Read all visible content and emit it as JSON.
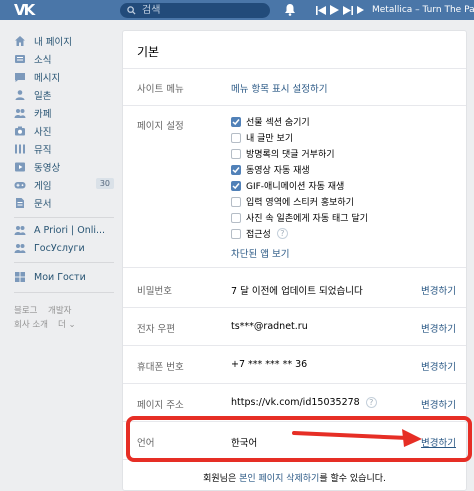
{
  "header": {
    "logo": "VK",
    "search_placeholder": "검색",
    "track": "Metallica – Turn The Page"
  },
  "sidebar": {
    "items": [
      {
        "label": "내 페이지",
        "icon": "home-icon"
      },
      {
        "label": "소식",
        "icon": "news-icon"
      },
      {
        "label": "메시지",
        "icon": "message-icon"
      },
      {
        "label": "일촌",
        "icon": "friends-icon"
      },
      {
        "label": "카페",
        "icon": "groups-icon"
      },
      {
        "label": "사진",
        "icon": "camera-icon"
      },
      {
        "label": "뮤직",
        "icon": "music-icon"
      },
      {
        "label": "동영상",
        "icon": "video-icon"
      },
      {
        "label": "게임",
        "icon": "gamepad-icon",
        "count": "30"
      },
      {
        "label": "문서",
        "icon": "document-icon"
      }
    ],
    "apps": [
      {
        "label": "A Priori | Onli...",
        "icon": "app-icon"
      },
      {
        "label": "ГосУслуги",
        "icon": "app-icon"
      }
    ],
    "extra": [
      {
        "label": "Мои Гости",
        "icon": "grid-icon"
      }
    ],
    "footer": [
      "블로그",
      "개발자",
      "회사 소개",
      "더 ⌄"
    ]
  },
  "settings": {
    "title": "기본",
    "site_menu": {
      "label": "사이트 메뉴",
      "link": "메뉴 항목 표시 설정하기"
    },
    "page_settings": {
      "label": "페이지 설정",
      "options": [
        {
          "label": "선물 섹션 숨기기",
          "checked": true
        },
        {
          "label": "내 글만 보기",
          "checked": false
        },
        {
          "label": "방명록의 댓글 거부하기",
          "checked": false
        },
        {
          "label": "동영상 자동 재생",
          "checked": true
        },
        {
          "label": "GIF-애니메이션 자동 재생",
          "checked": true
        },
        {
          "label": "입력 영역에 스티커 홍보하기",
          "checked": false
        },
        {
          "label": "사진 속 일촌에게 자동 태그 달기",
          "checked": false
        },
        {
          "label": "접근성",
          "checked": false,
          "help": "?"
        }
      ],
      "blocked_apps": "차단된 앱 보기"
    },
    "password": {
      "label": "비밀번호",
      "value": "7 달 이전에 업데이트 되었습니다",
      "action": "변경하기"
    },
    "email": {
      "label": "전자 우편",
      "value": "ts***@radnet.ru",
      "action": "변경하기"
    },
    "phone": {
      "label": "휴대폰 번호",
      "value": "+7 *** *** ** 36",
      "action": "변경하기"
    },
    "page_address": {
      "label": "페이지 주소",
      "value": "https://vk.com/id15035278",
      "help": "?",
      "action": "변경하기"
    },
    "language": {
      "label": "언어",
      "value": "한국어",
      "action": "변경하기"
    },
    "delete_note": {
      "prefix": "회원님은 ",
      "link": "본인 페이지 삭제하기",
      "suffix": "를 할수 있습니다."
    }
  },
  "colors": {
    "header": "#4a76a8",
    "link": "#2a5885",
    "checkbox": "#5181b8",
    "annotation": "#e62e25"
  }
}
